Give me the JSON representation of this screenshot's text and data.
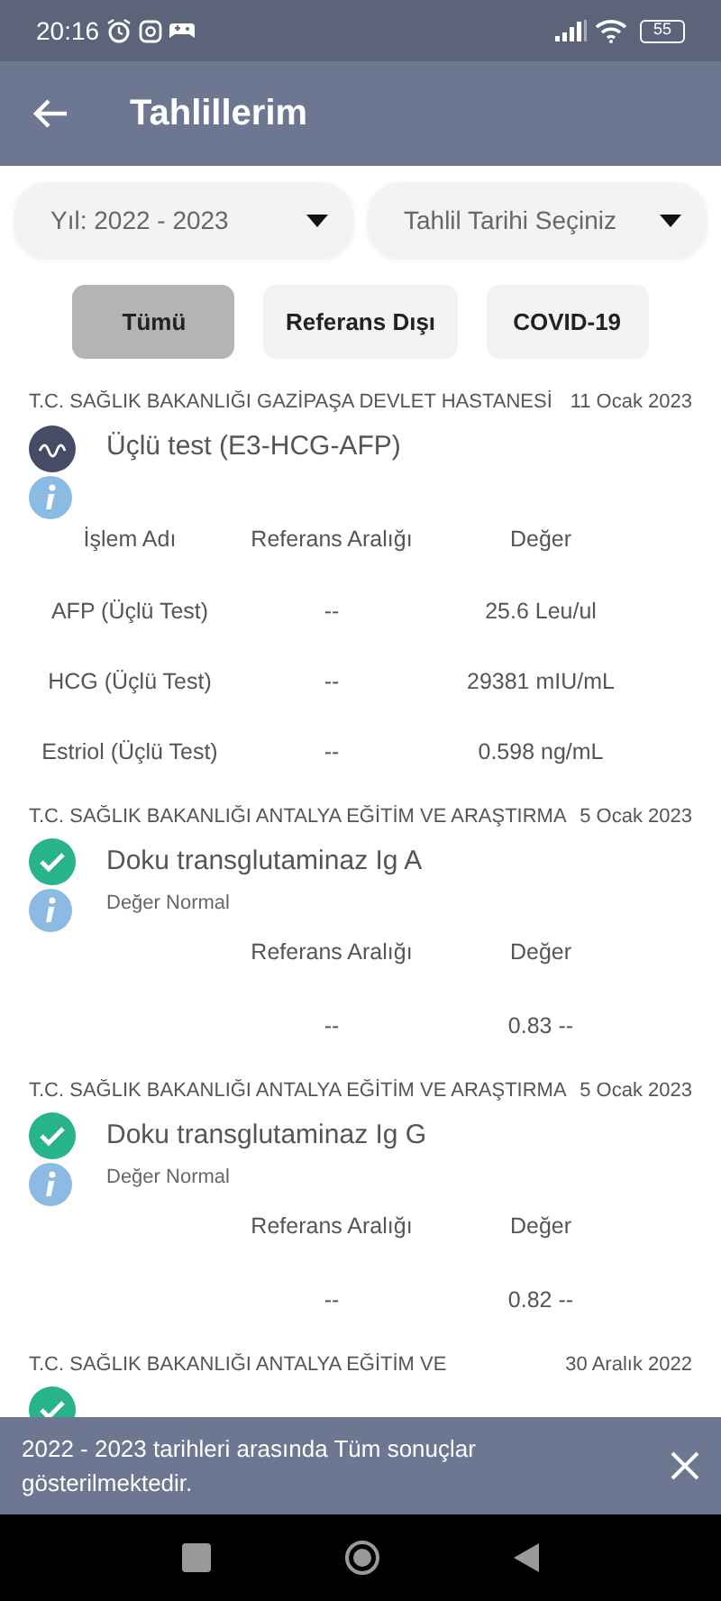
{
  "status_bar": {
    "time": "20:16",
    "battery": "55"
  },
  "app_bar": {
    "title": "Tahlillerim"
  },
  "filters": {
    "year": "Yıl: 2022 - 2023",
    "date": {
      "placeholder": "Tahlil Tarihi Seçiniz"
    }
  },
  "tabs": [
    {
      "label": "Tümü",
      "selected": true
    },
    {
      "label": "Referans Dışı",
      "selected": false
    },
    {
      "label": "COVID-19",
      "selected": false
    }
  ],
  "results": [
    {
      "hospital": "T.C. SAĞLIK BAKANLIĞI GAZİPAŞA DEVLET HASTANESİ",
      "date": "11 Ocak 2023",
      "kind": "pending",
      "title": "Üçlü test (E3-HCG-AFP)",
      "columns": [
        {
          "kind": "name",
          "label": "İşlem Adı"
        },
        {
          "kind": "range",
          "label": "Referans Aralığı"
        },
        {
          "kind": "value",
          "label": "Değer"
        }
      ],
      "rows": [
        {
          "name": "AFP (Üçlü Test)",
          "range": "--",
          "value": "25.6 Leu/ul"
        },
        {
          "name": "HCG (Üçlü Test)",
          "range": "--",
          "value": "29381 mIU/mL"
        },
        {
          "name": "Estriol (Üçlü Test)",
          "range": "--",
          "value": "0.598 ng/mL"
        }
      ]
    },
    {
      "hospital": "T.C. SAĞLIK BAKANLIĞI ANTALYA EĞİTİM VE ARAŞTIRMA",
      "date": "5 Ocak 2023",
      "kind": "normal",
      "title": "Doku transglutaminaz Ig A",
      "note": "Değer Normal",
      "columns": [
        {
          "kind": "range",
          "label": "Referans Aralığı"
        },
        {
          "kind": "value",
          "label": "Değer"
        }
      ],
      "rows": [
        {
          "range": "--",
          "value": "0.83 --"
        }
      ]
    },
    {
      "hospital": "T.C. SAĞLIK BAKANLIĞI ANTALYA EĞİTİM VE ARAŞTIRMA",
      "date": "5 Ocak 2023",
      "kind": "normal",
      "title": "Doku transglutaminaz Ig G",
      "note": "Değer Normal",
      "columns": [
        {
          "kind": "range",
          "label": "Referans Aralığı"
        },
        {
          "kind": "value",
          "label": "Değer"
        }
      ],
      "rows": [
        {
          "range": "--",
          "value": "0.82 --"
        }
      ]
    },
    {
      "hospital": "T.C. SAĞLIK BAKANLIĞI ANTALYA EĞİTİM VE",
      "date": "30 Aralık 2022",
      "kind": "normal"
    }
  ],
  "snackbar": {
    "message": "2022 - 2023 tarihleri arasında Tüm sonuçlar gösterilmektedir."
  }
}
